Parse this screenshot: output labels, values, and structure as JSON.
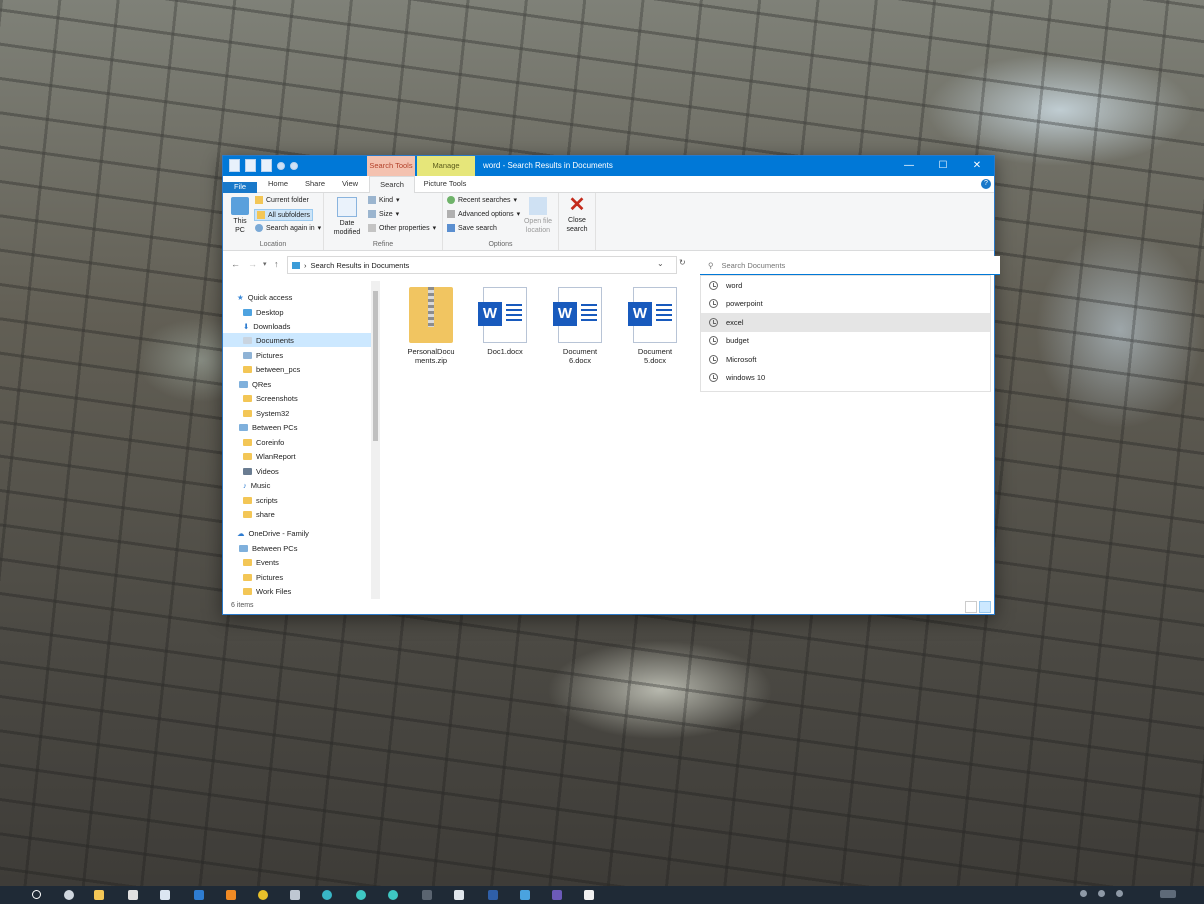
{
  "window": {
    "title": "word - Search Results in Documents",
    "context_tabs": {
      "search_tools": "Search Tools",
      "manage": "Manage"
    },
    "controls": {
      "minimize": "—",
      "maximize": "☐",
      "close": "✕"
    }
  },
  "ribbon_tabs": [
    "File",
    "Home",
    "Share",
    "View",
    "Search",
    "Picture Tools"
  ],
  "ribbon": {
    "location": {
      "this_pc": "This PC",
      "current_folder": "Current folder",
      "all_subfolders": "All subfolders",
      "search_again_in": "Search again in",
      "label": "Location"
    },
    "refine": {
      "date_modified": "Date modified",
      "kind": "Kind",
      "size": "Size",
      "other_properties": "Other properties",
      "label": "Refine"
    },
    "options": {
      "recent_searches": "Recent searches",
      "advanced_options": "Advanced options",
      "save_search": "Save search",
      "open_file_location": "Open file location",
      "label": "Options"
    },
    "close_search": "Close search"
  },
  "address": {
    "path": "Search Results in Documents",
    "back": "←",
    "forward": "→",
    "up": "↑"
  },
  "search": {
    "placeholder": "Search Documents",
    "suggestions": [
      "word",
      "powerpoint",
      "excel",
      "budget",
      "Microsoft",
      "windows 10"
    ]
  },
  "nav": {
    "quick_access": "Quick access",
    "items": [
      "Desktop",
      "Downloads",
      "Documents",
      "Pictures",
      "between_pcs",
      "QRes",
      "Screenshots",
      "System32",
      "Between PCs",
      "Coreinfo",
      "WlanReport",
      "Videos",
      "Music",
      "scripts",
      "share"
    ],
    "onedrive": "OneDrive - Family",
    "onedrive_items": [
      "Between PCs",
      "Events",
      "Pictures",
      "Work Files"
    ]
  },
  "files": [
    {
      "name": "PersonalDocuments.zip",
      "line1": "PersonalDocu",
      "line2": "ments.zip",
      "icon": "zip-icon"
    },
    {
      "name": "Doc1.docx",
      "line1": "Doc1.docx",
      "line2": "",
      "icon": "word-icon"
    },
    {
      "name": "Document6.docx",
      "line1": "Document",
      "line2": "6.docx",
      "icon": "word-icon"
    },
    {
      "name": "Document5.docx",
      "line1": "Document",
      "line2": "5.docx",
      "icon": "word-icon"
    }
  ],
  "status": {
    "items": "6 items"
  },
  "colors": {
    "accent": "#0078d7",
    "folder": "#f3c656",
    "word": "#185abd"
  }
}
